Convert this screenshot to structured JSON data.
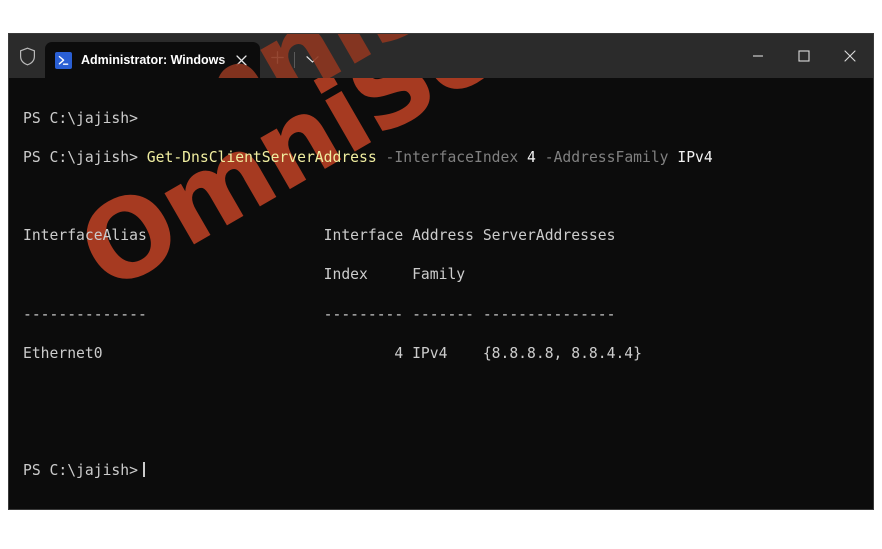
{
  "window": {
    "titlebar": {
      "shield_icon": "shield-icon",
      "tab": {
        "icon": "powershell-icon",
        "title": "Administrator: Windows Powe",
        "close_icon": "close-icon"
      },
      "new_tab_icon": "plus-icon",
      "dropdown_icon": "chevron-down-icon",
      "controls": {
        "minimize_icon": "minimize-icon",
        "maximize_icon": "maximize-icon",
        "close_icon": "close-icon"
      }
    },
    "terminal": {
      "prompt": "PS C:\\jajish>",
      "line1": {
        "prompt": "PS C:\\jajish>"
      },
      "line2": {
        "prompt": "PS C:\\jajish> ",
        "cmdlet": "Get-DnsClientServerAddress",
        "param1": " -InterfaceIndex ",
        "value1": "4",
        "param2": " -AddressFamily ",
        "value2": "IPv4"
      },
      "table": {
        "header_row1": "InterfaceAlias                    Interface Address ServerAddresses",
        "header_row2": "                                  Index     Family",
        "separator": "--------------                    --------- ------- ---------------",
        "data_row": "Ethernet0                                 4 IPv4    {8.8.8.8, 8.8.4.4}"
      },
      "final_prompt": "PS C:\\jajish>",
      "colors": {
        "background": "#0c0c0c",
        "foreground": "#cccccc",
        "cmdlet": "#f0eea0",
        "parameter": "#808080",
        "value": "#f2f2f2",
        "titlebar": "#2b2b2b"
      }
    },
    "watermark": {
      "text": "OmniSecu.com",
      "color": "#a63a21"
    }
  }
}
